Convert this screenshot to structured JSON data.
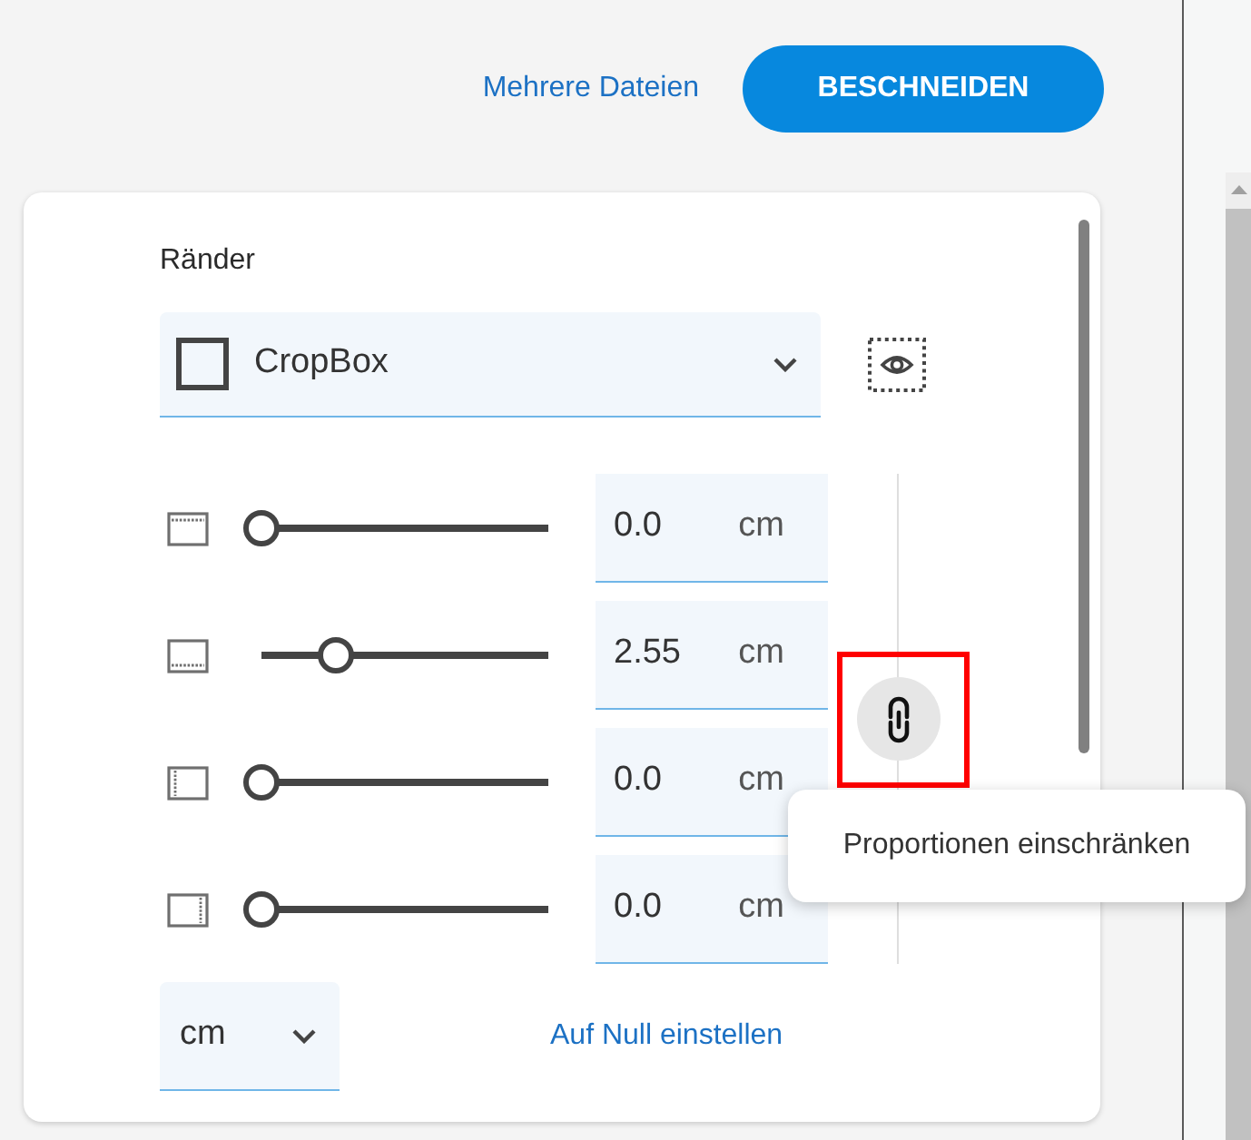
{
  "toolbar": {
    "link": "Mehrere Dateien",
    "button": "BESCHNEIDEN"
  },
  "margins_panel": {
    "title": "Ränder",
    "box_select": {
      "value": "CropBox"
    },
    "margins": [
      {
        "kind": "top",
        "level": 0,
        "value": "0.0",
        "unit": "cm"
      },
      {
        "kind": "bottom",
        "level": 0.28,
        "value": "2.55",
        "unit": "cm"
      },
      {
        "kind": "left",
        "level": 0,
        "value": "0.0",
        "unit": "cm"
      },
      {
        "kind": "right",
        "level": 0,
        "value": "0.0",
        "unit": "cm"
      }
    ],
    "constrain_button": {
      "highlighted": true,
      "tooltip": "Proportionen einschränken"
    },
    "unit_select": {
      "value": "cm"
    },
    "reset_link": "Auf Null einstellen"
  }
}
